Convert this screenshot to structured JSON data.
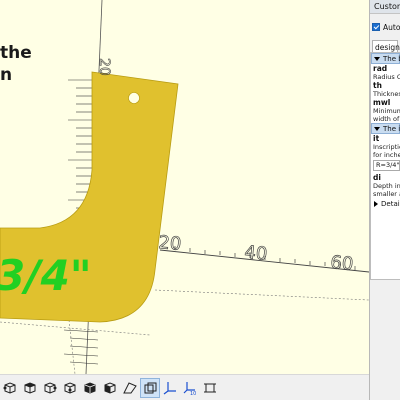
{
  "panel": {
    "title": "Customizer",
    "automatic_preview_label": "Automatic Preview",
    "preset_label": "design default values",
    "groups": [
      {
        "header": "The b",
        "params": [
          {
            "name": "rad",
            "desc": "Radius Cu"
          },
          {
            "name": "th",
            "desc": "Thickness"
          },
          {
            "name": "mwl",
            "desc": "Minimum",
            "desc2": "width of t"
          }
        ]
      },
      {
        "header": "The ir",
        "params": [
          {
            "name": "it",
            "desc": "Inscriptio",
            "desc2": "for inches",
            "value": "R=3/4\""
          },
          {
            "name": "di",
            "desc": "Depth ins",
            "desc2": "smaller a"
          }
        ]
      }
    ],
    "details_label": "Detail"
  },
  "viewport": {
    "overlay_line1": "the",
    "overlay_line2": "n",
    "model_inscription": "3/4\"",
    "ruler_labels": [
      "20",
      "40",
      "60"
    ],
    "vertical_ruler_label": "20"
  },
  "toolbar": {
    "icons": [
      "view-right-icon",
      "view-top-icon",
      "view-bottom-icon",
      "view-left-icon",
      "view-back-icon",
      "view-diagonal-icon",
      "perspective-icon",
      "orthogonal-icon",
      "show-axes-icon",
      "show-scale-markers-icon",
      "show-edges-icon"
    ]
  },
  "colors": {
    "viewport_bg": "#ffffe5",
    "model": "#e0c12e",
    "inscription": "#22d022",
    "axis": "#333333",
    "panel_bg": "#f0f0f0",
    "group_header": "#c9dcf0"
  }
}
